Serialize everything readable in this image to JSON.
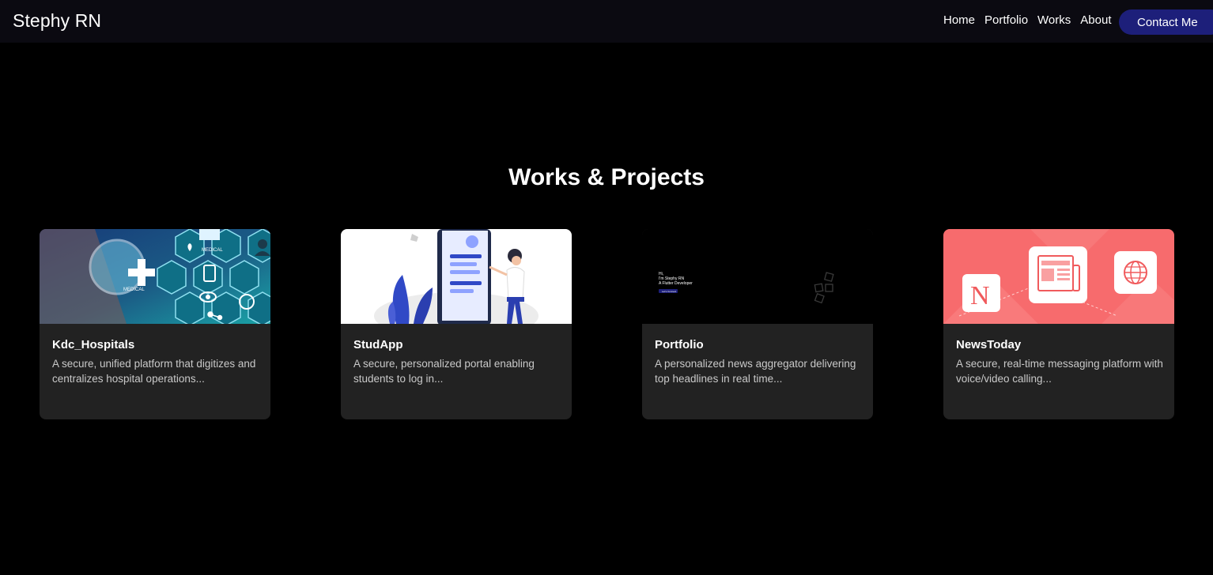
{
  "navbar": {
    "brand": "Stephy RN",
    "links": [
      "Home",
      "Portfolio",
      "Works",
      "About"
    ],
    "contact_label": "Contact Me"
  },
  "section": {
    "title": "Works & Projects"
  },
  "cards": [
    {
      "title": "Kdc_Hospitals",
      "description": "A secure, unified platform that digitizes and centralizes hospital operations...",
      "thumb_labels": [
        "MEDICAL",
        "MEDICAL"
      ]
    },
    {
      "title": "StudApp",
      "description": "A secure, personalized portal enabling students to log in..."
    },
    {
      "title": "Portfolio",
      "description": "A personalized news aggregator delivering top headlines in real time...",
      "thumb_text": [
        "Hi,",
        "I'm Stephy RN",
        "A Flutter Developer",
        "Let's Connect"
      ]
    },
    {
      "title": "NewsToday",
      "description": "A secure, real-time messaging platform with voice/video calling...",
      "thumb_letter": "N"
    }
  ],
  "colors": {
    "page_bg": "#000000",
    "navbar_bg": "#0b0a11",
    "accent": "#1d1f7a",
    "card_bg": "#222222",
    "news_thumb": "#f76b6d"
  }
}
